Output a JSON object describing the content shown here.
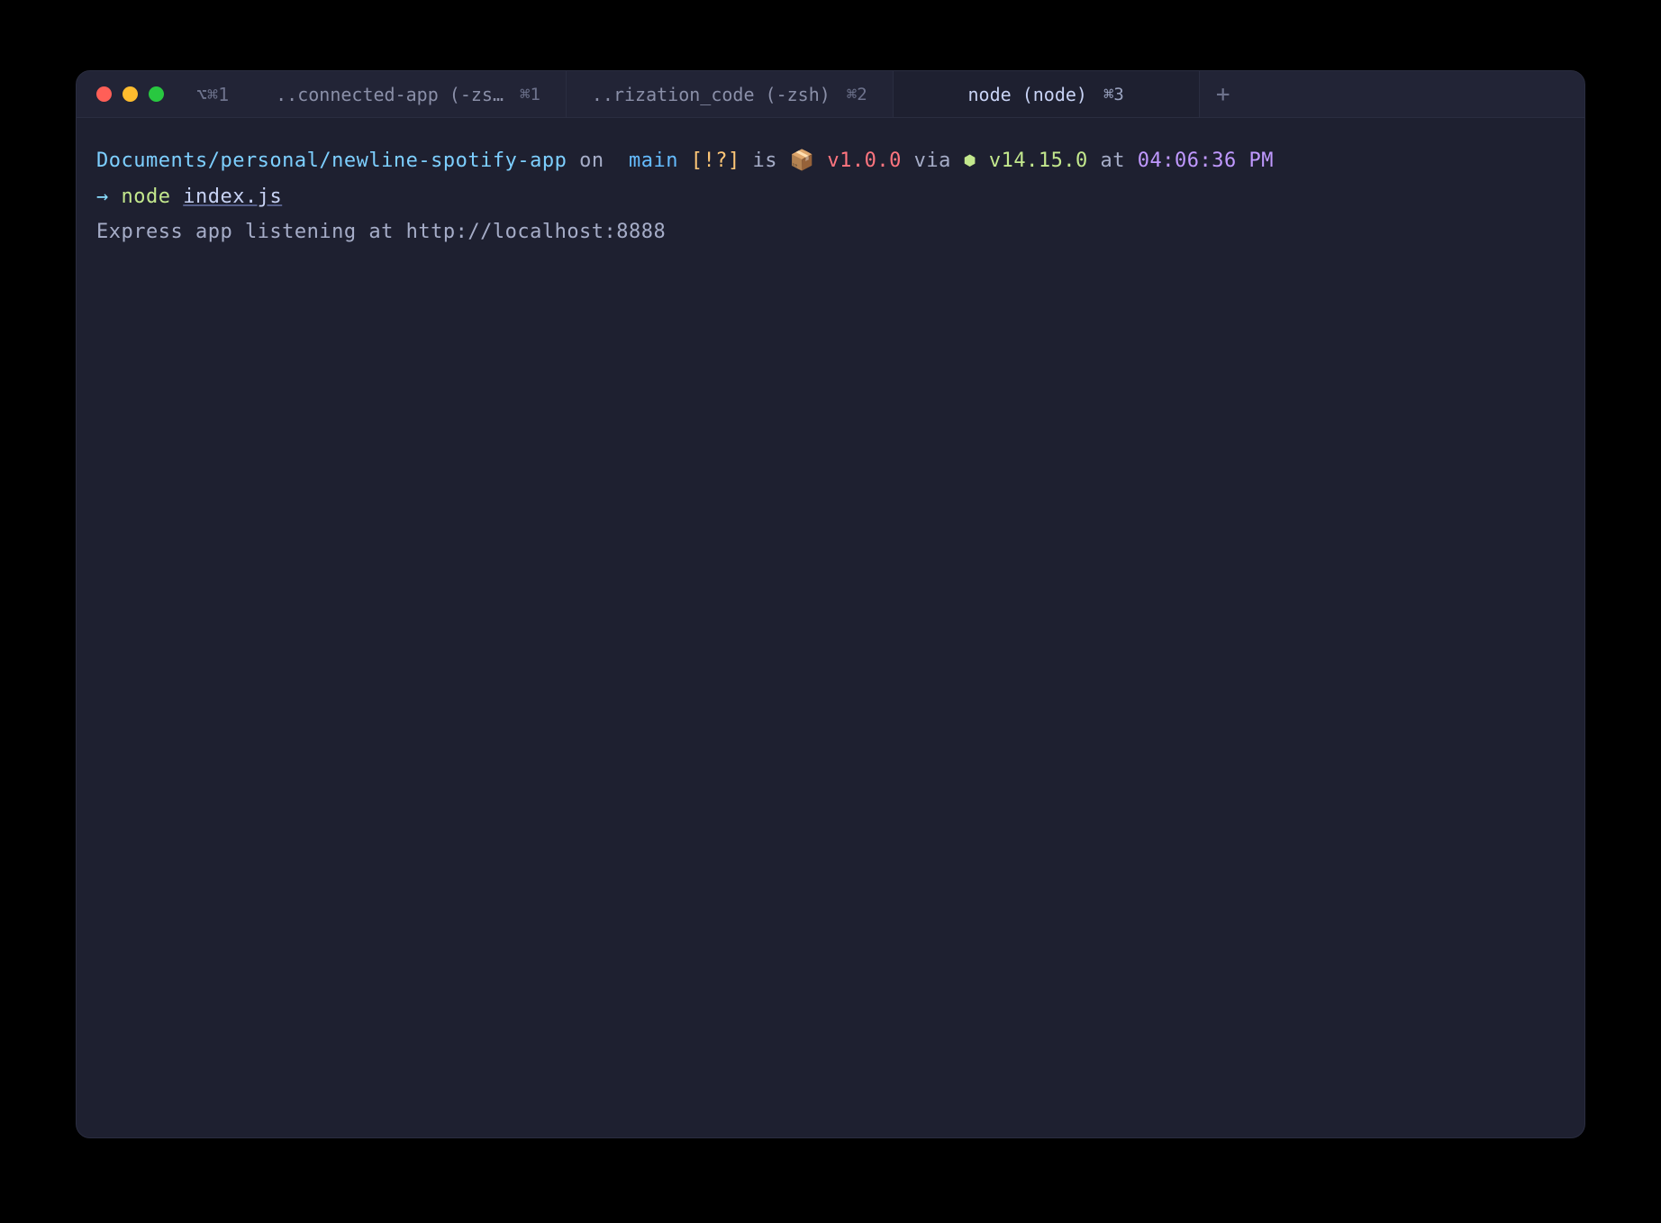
{
  "window": {
    "hotkey_hint": "⌥⌘1"
  },
  "tabs": [
    {
      "label": "..connected-app (-zs…",
      "shortcut": "⌘1",
      "active": false
    },
    {
      "label": "..rization_code (-zsh)",
      "shortcut": "⌘2",
      "active": false
    },
    {
      "label": "node (node)",
      "shortcut": "⌘3",
      "active": true
    }
  ],
  "new_tab_label": "+",
  "prompt": {
    "path": "Documents/personal/newline-spotify-app",
    "on_word": " on ",
    "git_icon": "",
    "branch": " main ",
    "status_flags": "[!?]",
    "is_word": " is ",
    "pkg_icon": "📦",
    "pkg_version": " v1.0.0 ",
    "via_word": "via ",
    "node_icon": "⬢",
    "node_version": " v14.15.0 ",
    "at_word": "at ",
    "time": "04:06:36 PM"
  },
  "command": {
    "arrow": "→ ",
    "cmd": "node ",
    "arg": "index.js"
  },
  "output": {
    "line1": "Express app listening at http://localhost:8888"
  }
}
